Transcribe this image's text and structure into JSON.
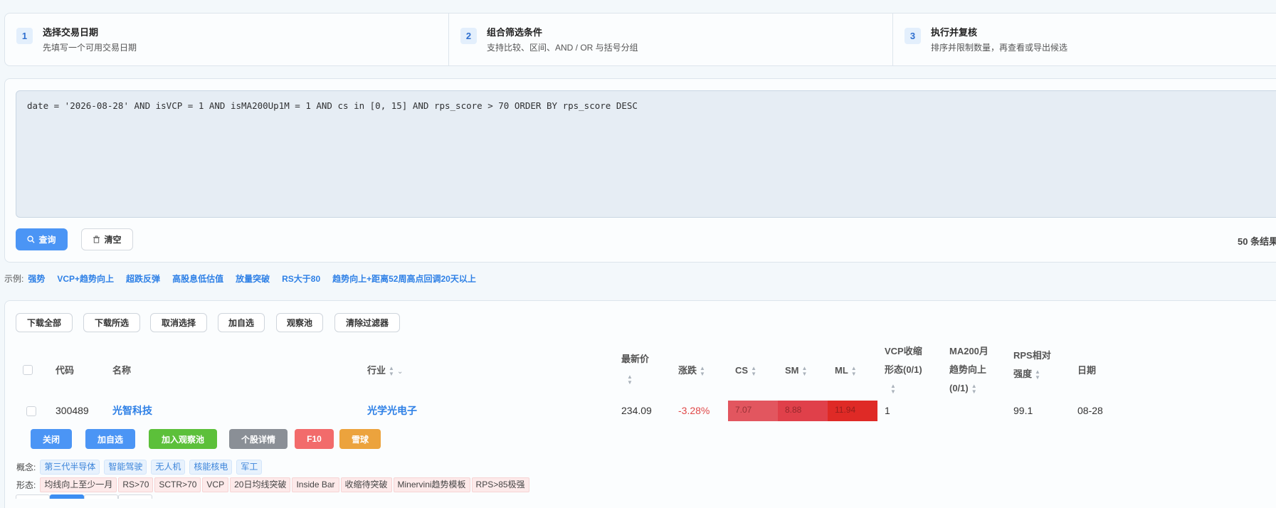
{
  "steps": [
    {
      "num": "1",
      "title": "选择交易日期",
      "desc": "先填写一个可用交易日期"
    },
    {
      "num": "2",
      "title": "组合筛选条件",
      "desc": "支持比较、区间、AND / OR 与括号分组"
    },
    {
      "num": "3",
      "title": "执行并复核",
      "desc": "排序并限制数量，再查看或导出候选"
    }
  ],
  "query": {
    "text": "date = '2026-08-28' AND isVCP = 1 AND isMA200Up1M = 1 AND cs in [0, 15] AND rps_score > 70 ORDER BY rps_score DESC",
    "query_label": "查询",
    "clear_label": "清空",
    "result_count": "50 条结果"
  },
  "examples": {
    "label": "示例:",
    "items": [
      "强势",
      "VCP+趋势向上",
      "超跌反弹",
      "高股息低估值",
      "放量突破",
      "RS大于80",
      "趋势向上+距离52周高点回调20天以上"
    ]
  },
  "toolbar": {
    "download_all": "下载全部",
    "download_selected": "下载所选",
    "deselect": "取消选择",
    "add_favorite": "加自选",
    "watch_pool": "观察池",
    "clear_filters": "清除过滤器"
  },
  "table": {
    "headers": {
      "code": "代码",
      "name": "名称",
      "industry": "行业",
      "price": "最新价",
      "change": "涨跌",
      "cs": "CS",
      "sm": "SM",
      "ml": "ML",
      "vcp_1": "VCP收缩",
      "vcp_2": "形态(0/1)",
      "ma200_1": "MA200月",
      "ma200_2": "趋势向上",
      "ma200_3": "(0/1)",
      "rps_1": "RPS相对",
      "rps_2": "强度",
      "date": "日期"
    },
    "row": {
      "code": "300489",
      "name": "光智科技",
      "industry": "光学光电子",
      "price": "234.09",
      "change": "-3.28%",
      "cs": "7.07",
      "sm": "8.88",
      "ml": "11.94",
      "vcp": "1",
      "rps": "99.1",
      "date": "08-28"
    }
  },
  "row_actions": {
    "close": "关闭",
    "add_favorite": "加自选",
    "add_watch": "加入观察池",
    "detail": "个股详情",
    "f10": "F10",
    "xueqiu": "雪球"
  },
  "concepts": {
    "label": "概念:",
    "tags": [
      "第三代半导体",
      "智能驾驶",
      "无人机",
      "核能核电",
      "军工"
    ]
  },
  "patterns": {
    "label": "形态:",
    "tags": [
      "均线向上至少一月",
      "RS>70",
      "SCTR>70",
      "VCP",
      "20日均线突破",
      "Inside Bar",
      "收缩待突破",
      "Minervini趋势模板",
      "RPS>85极强"
    ]
  },
  "colors": {
    "primary": "#4b95f5",
    "link": "#2e80e6",
    "negative": "#e04848",
    "heat_cs": "#e2565f",
    "heat_sm": "#e0404a",
    "heat_ml": "#df2a26",
    "btn_green": "#5cc03a",
    "btn_gray": "#8a8f96",
    "btn_red": "#f26b6b",
    "btn_orange": "#eca33d"
  }
}
